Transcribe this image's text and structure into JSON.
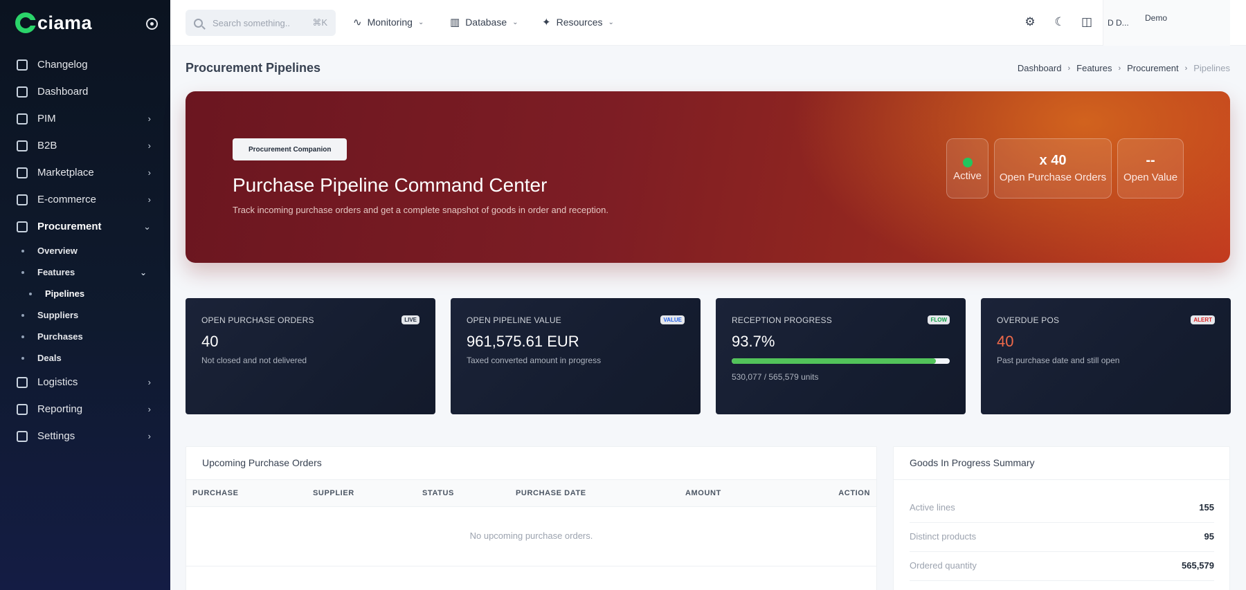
{
  "brand": {
    "name": "ciama"
  },
  "sidebar": {
    "items": [
      {
        "label": "Changelog",
        "chevron": ""
      },
      {
        "label": "Dashboard",
        "chevron": ""
      },
      {
        "label": "PIM",
        "chevron": "›"
      },
      {
        "label": "B2B",
        "chevron": "›"
      },
      {
        "label": "Marketplace",
        "chevron": "›"
      },
      {
        "label": "E-commerce",
        "chevron": "›"
      },
      {
        "label": "Procurement",
        "chevron": "⌄"
      }
    ],
    "procurement_sub": [
      {
        "label": "Overview"
      },
      {
        "label": "Features",
        "chevron": "⌄"
      },
      {
        "label": "Pipelines"
      },
      {
        "label": "Suppliers"
      },
      {
        "label": "Purchases"
      },
      {
        "label": "Deals"
      }
    ],
    "bottom_items": [
      {
        "label": "Logistics",
        "chevron": "›"
      },
      {
        "label": "Reporting",
        "chevron": "›"
      },
      {
        "label": "Settings",
        "chevron": "›"
      }
    ]
  },
  "topbar": {
    "search_placeholder": "Search something..",
    "search_shortcut": "⌘K",
    "menus": [
      {
        "label": "Monitoring",
        "icon": "activity-icon",
        "glyph": "∿"
      },
      {
        "label": "Database",
        "icon": "database-icon",
        "glyph": "▥"
      },
      {
        "label": "Resources",
        "icon": "sparkles-icon",
        "glyph": "✦"
      }
    ],
    "icons": {
      "settings": "⚙",
      "theme": "☾",
      "notifications": "◫"
    },
    "user": {
      "initials": "D D...",
      "name": "Demo"
    }
  },
  "page": {
    "title": "Procurement Pipelines",
    "breadcrumb": [
      "Dashboard",
      "Features",
      "Procurement",
      "Pipelines"
    ],
    "breadcrumb_sep": "›"
  },
  "hero": {
    "badge": "Procurement Companion",
    "title": "Purchase Pipeline Command Center",
    "subtitle": "Track incoming purchase orders and get a complete snapshot of goods in order and reception.",
    "status_label": "Active",
    "status_color": "#22c55e",
    "orders_value": "x 40",
    "orders_label": "Open Purchase Orders",
    "open_value": "--",
    "open_value_label": "Open Value"
  },
  "kpis": [
    {
      "label": "OPEN PURCHASE ORDERS",
      "tag": "LIVE",
      "tag_color": "#1e293b",
      "value": "40",
      "sub": "Not closed and not delivered"
    },
    {
      "label": "OPEN PIPELINE VALUE",
      "tag": "VALUE",
      "tag_color": "#2563eb",
      "value": "961,575.61 EUR",
      "sub": "Taxed converted amount in progress"
    },
    {
      "label": "RECEPTION PROGRESS",
      "tag": "FLOW",
      "tag_color": "#16a34a",
      "value": "93.7%",
      "progress_percent": 93.7,
      "sub": "530,077 / 565,579 units"
    },
    {
      "label": "OVERDUE POS",
      "tag": "ALERT",
      "tag_color": "#dc2626",
      "value": "40",
      "value_color": "#f06a4a",
      "sub": "Past purchase date and still open"
    }
  ],
  "upcoming": {
    "title": "Upcoming Purchase Orders",
    "columns": [
      "PURCHASE",
      "SUPPLIER",
      "STATUS",
      "PURCHASE DATE",
      "AMOUNT",
      "ACTION"
    ],
    "empty_text": "No upcoming purchase orders."
  },
  "summary": {
    "title": "Goods In Progress Summary",
    "rows": [
      {
        "label": "Active lines",
        "value": "155"
      },
      {
        "label": "Distinct products",
        "value": "95"
      },
      {
        "label": "Ordered quantity",
        "value": "565,579"
      }
    ]
  }
}
